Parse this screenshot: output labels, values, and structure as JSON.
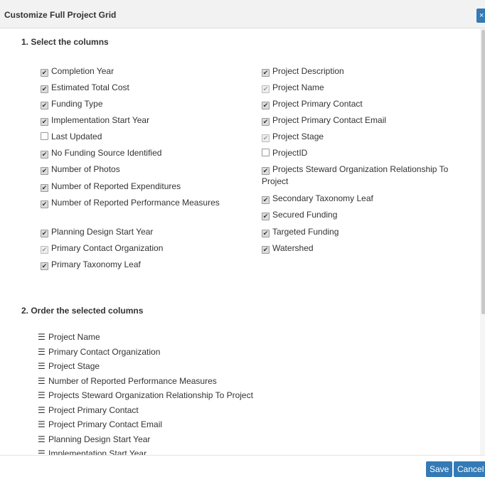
{
  "dialog": {
    "title": "Customize Full Project Grid",
    "close_label": "×"
  },
  "section1": {
    "title": "1. Select the columns"
  },
  "section2": {
    "title": "2. Order the selected columns"
  },
  "columns_left": [
    {
      "label": "Completion Year",
      "state": "checked"
    },
    {
      "label": "Estimated Total Cost",
      "state": "checked"
    },
    {
      "label": "Funding Type",
      "state": "checked"
    },
    {
      "label": "Implementation Start Year",
      "state": "checked"
    },
    {
      "label": "Last Updated",
      "state": "unchecked"
    },
    {
      "label": "No Funding Source Identified",
      "state": "checked"
    },
    {
      "label": "Number of Photos",
      "state": "checked"
    },
    {
      "label": "Number of Reported Expenditures",
      "state": "checked"
    },
    {
      "label": "Number of Reported Performance Measures",
      "state": "checked"
    },
    {
      "label": "Planning Design Start Year",
      "state": "checked"
    },
    {
      "label": "Primary Contact Organization",
      "state": "disabled"
    },
    {
      "label": "Primary Taxonomy Leaf",
      "state": "checked"
    }
  ],
  "columns_right": [
    {
      "label": "Project Description",
      "state": "checked"
    },
    {
      "label": "Project Name",
      "state": "disabled"
    },
    {
      "label": "Project Primary Contact",
      "state": "checked"
    },
    {
      "label": "Project Primary Contact Email",
      "state": "checked"
    },
    {
      "label": "Project Stage",
      "state": "disabled"
    },
    {
      "label": "ProjectID",
      "state": "unchecked"
    },
    {
      "label": "Projects Steward Organization Relationship To Project",
      "state": "checked"
    },
    {
      "label": "Secondary Taxonomy Leaf",
      "state": "checked"
    },
    {
      "label": "Secured Funding",
      "state": "checked"
    },
    {
      "label": "Targeted Funding",
      "state": "checked"
    },
    {
      "label": "Watershed",
      "state": "checked"
    }
  ],
  "order": [
    "Project Name",
    "Primary Contact Organization",
    "Project Stage",
    "Number of Reported Performance Measures",
    "Projects Steward Organization Relationship To Project",
    "Project Primary Contact",
    "Project Primary Contact Email",
    "Planning Design Start Year",
    "Implementation Start Year"
  ],
  "footer": {
    "save_label": "Save",
    "cancel_label": "Cancel"
  },
  "icons": {
    "checkbox": "checkbox-icon",
    "grip": "drag-handle-icon",
    "close": "close-icon"
  },
  "colors": {
    "accent": "#337ab7"
  }
}
